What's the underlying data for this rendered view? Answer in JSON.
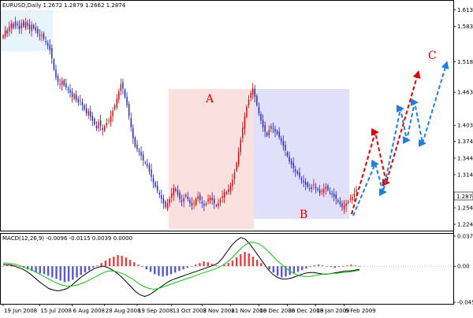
{
  "chart_data": {
    "type": "candlestick",
    "symbol_line": "EURUSD,Daily  1.2672 1.2879 1.2662 1.2874",
    "current_price_label": "1.2874",
    "price_axis_ticks": [
      "1.6130",
      "1.5830",
      "1.5185",
      "1.4635",
      "1.4035",
      "1.3745",
      "1.3440",
      "1.3140",
      "1.2874",
      "1.2540",
      "1.2240"
    ],
    "price_range": [
      1.214,
      1.625
    ],
    "x_ticks": [
      {
        "label": "19 Jun 2008",
        "i": 0
      },
      {
        "label": "15 Jul 2008",
        "i": 18
      },
      {
        "label": "6 Aug 2008",
        "i": 34
      },
      {
        "label": "28 Aug 2008",
        "i": 50
      },
      {
        "label": "19 Sep 2008",
        "i": 66
      },
      {
        "label": "13 Oct 2008",
        "i": 83
      },
      {
        "label": "3 Nov 2008",
        "i": 98
      },
      {
        "label": "21 Nov 2008",
        "i": 112
      },
      {
        "label": "10 Dec 2008",
        "i": 126
      },
      {
        "label": "30 Dec 2008",
        "i": 140
      },
      {
        "label": "19 Jan 2009",
        "i": 154
      },
      {
        "label": "6 Feb 2009",
        "i": 168
      }
    ],
    "close_series": [
      1.566,
      1.575,
      1.57,
      1.582,
      1.588,
      1.58,
      1.592,
      1.585,
      1.578,
      1.589,
      1.583,
      1.59,
      1.584,
      1.578,
      1.586,
      1.58,
      1.575,
      1.57,
      1.566,
      1.568,
      1.56,
      1.554,
      1.548,
      1.54,
      1.525,
      1.505,
      1.49,
      1.482,
      1.478,
      1.484,
      1.476,
      1.472,
      1.468,
      1.462,
      1.455,
      1.46,
      1.45,
      1.445,
      1.448,
      1.44,
      1.432,
      1.425,
      1.43,
      1.42,
      1.412,
      1.405,
      1.398,
      1.41,
      1.402,
      1.395,
      1.402,
      1.408,
      1.412,
      1.42,
      1.43,
      1.44,
      1.452,
      1.465,
      1.478,
      1.47,
      1.455,
      1.44,
      1.42,
      1.4,
      1.38,
      1.365,
      1.36,
      1.355,
      1.348,
      1.34,
      1.335,
      1.33,
      1.32,
      1.31,
      1.3,
      1.292,
      1.285,
      1.278,
      1.27,
      1.262,
      1.255,
      1.262,
      1.27,
      1.28,
      1.29,
      1.285,
      1.278,
      1.27,
      1.265,
      1.272,
      1.278,
      1.27,
      1.262,
      1.258,
      1.262,
      1.27,
      1.275,
      1.268,
      1.262,
      1.258,
      1.262,
      1.27,
      1.272,
      1.268,
      1.262,
      1.258,
      1.262,
      1.268,
      1.275,
      1.282,
      1.28,
      1.288,
      1.295,
      1.305,
      1.318,
      1.335,
      1.355,
      1.378,
      1.4,
      1.42,
      1.438,
      1.45,
      1.462,
      1.47,
      1.455,
      1.44,
      1.425,
      1.412,
      1.4,
      1.392,
      1.385,
      1.395,
      1.402,
      1.398,
      1.392,
      1.388,
      1.382,
      1.375,
      1.366,
      1.358,
      1.348,
      1.338,
      1.332,
      1.326,
      1.32,
      1.316,
      1.31,
      1.304,
      1.3,
      1.296,
      1.292,
      1.288,
      1.292,
      1.296,
      1.29,
      1.286,
      1.28,
      1.284,
      1.288,
      1.292,
      1.286,
      1.282,
      1.278,
      1.274,
      1.27,
      1.265,
      1.26,
      1.255,
      1.258,
      1.262,
      1.265,
      1.27,
      1.274,
      1.28,
      1.2874
    ],
    "macd_indicator_label": "MACD(12,26,9) -0.0096 -0.0115 0.0039 0.0000",
    "macd_axis_ticks": [
      "0.0378",
      "0.00",
      "-0.0453"
    ],
    "macd_range": [
      -0.0453,
      0.0378
    ],
    "histogram_pattern": [
      0.0,
      0.001,
      0.002,
      0.001,
      0.0,
      -0.002,
      -0.004,
      -0.006,
      -0.008,
      -0.009,
      -0.01,
      -0.012,
      -0.014,
      -0.016,
      -0.018,
      -0.02,
      -0.019,
      -0.017,
      -0.014,
      -0.011,
      -0.008,
      -0.005,
      -0.002,
      0.001,
      0.004,
      0.007,
      0.01,
      0.012,
      0.014,
      0.013,
      0.011,
      0.008,
      0.005,
      0.002,
      -0.001,
      -0.004,
      -0.007,
      -0.01,
      -0.012,
      -0.013,
      -0.012,
      -0.01,
      -0.008,
      -0.006,
      -0.004,
      -0.002,
      0.0,
      0.002,
      0.004,
      0.006,
      0.005,
      0.003,
      0.001,
      0.0,
      0.002,
      0.004,
      0.007,
      0.011,
      0.015,
      0.018,
      0.016,
      0.012,
      0.008,
      0.004,
      0.0,
      -0.004,
      -0.008,
      -0.012,
      -0.014,
      -0.013,
      -0.011,
      -0.009,
      -0.007,
      -0.005,
      -0.003,
      -0.001,
      0.001,
      0.002,
      0.001,
      0.0,
      -0.001,
      -0.002,
      -0.001,
      0.0,
      0.001,
      0.002,
      0.001,
      0.0
    ],
    "macd_line_pattern": [
      0.002,
      0.002,
      0.001,
      -0.001,
      -0.003,
      -0.006,
      -0.01,
      -0.015,
      -0.02,
      -0.024,
      -0.028,
      -0.03,
      -0.031,
      -0.03,
      -0.028,
      -0.024,
      -0.019,
      -0.014,
      -0.01,
      -0.006,
      -0.003,
      -0.001,
      0.0,
      -0.002,
      -0.005,
      -0.009,
      -0.014,
      -0.02,
      -0.026,
      -0.032,
      -0.036,
      -0.038,
      -0.036,
      -0.032,
      -0.028,
      -0.024,
      -0.02,
      -0.017,
      -0.015,
      -0.013,
      -0.011,
      -0.009,
      -0.007,
      -0.005,
      -0.003,
      -0.001,
      0.001,
      0.004,
      0.01,
      0.018,
      0.026,
      0.032,
      0.036,
      0.034,
      0.028,
      0.02,
      0.012,
      0.004,
      -0.004,
      -0.01,
      -0.014,
      -0.016,
      -0.016,
      -0.015,
      -0.013,
      -0.011,
      -0.009,
      -0.008,
      -0.008,
      -0.009,
      -0.01,
      -0.01,
      -0.009,
      -0.008,
      -0.007,
      -0.006,
      -0.006,
      -0.005,
      -0.004
    ],
    "signal_line_pattern": [
      0.004,
      0.004,
      0.003,
      0.002,
      0.0,
      -0.002,
      -0.004,
      -0.007,
      -0.01,
      -0.013,
      -0.016,
      -0.019,
      -0.022,
      -0.024,
      -0.025,
      -0.025,
      -0.024,
      -0.022,
      -0.02,
      -0.017,
      -0.014,
      -0.011,
      -0.008,
      -0.006,
      -0.006,
      -0.007,
      -0.009,
      -0.012,
      -0.015,
      -0.019,
      -0.023,
      -0.026,
      -0.028,
      -0.029,
      -0.028,
      -0.026,
      -0.024,
      -0.022,
      -0.02,
      -0.018,
      -0.016,
      -0.014,
      -0.012,
      -0.01,
      -0.008,
      -0.006,
      -0.004,
      -0.002,
      0.001,
      0.005,
      0.01,
      0.016,
      0.022,
      0.027,
      0.03,
      0.03,
      0.028,
      0.024,
      0.019,
      0.013,
      0.007,
      0.002,
      -0.003,
      -0.007,
      -0.01,
      -0.012,
      -0.013,
      -0.013,
      -0.012,
      -0.011,
      -0.01,
      -0.01,
      -0.009,
      -0.009,
      -0.008,
      -0.008,
      -0.007,
      -0.006,
      -0.005
    ]
  },
  "annotations": {
    "zone_a_label": "A",
    "zone_b_label": "B",
    "target_label": "C"
  },
  "colors": {
    "zone_a_fill": "#fbe0e0",
    "zone_b_fill": "#e0e0fb",
    "candle_up": "#e00000",
    "candle_down": "#2020c0",
    "macd_line": "#000000",
    "signal_line": "#10c010",
    "hist_up": "#e00000",
    "hist_down": "#2020c0",
    "arrow_red": "#e00000",
    "arrow_blue": "#1e7fe0",
    "start_box": "#e6f3fb"
  }
}
